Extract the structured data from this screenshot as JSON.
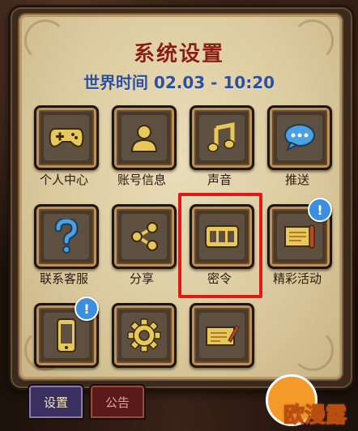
{
  "header": {
    "title": "系统设置",
    "world_time": "世界时间 02.03 - 10:20"
  },
  "tiles": [
    {
      "label": "个人中心",
      "icon": "gamepad-icon",
      "badge": ""
    },
    {
      "label": "账号信息",
      "icon": "person-icon",
      "badge": ""
    },
    {
      "label": "声音",
      "icon": "music-note-icon",
      "badge": ""
    },
    {
      "label": "推送",
      "icon": "chat-bubble-icon",
      "badge": ""
    },
    {
      "label": "联系客服",
      "icon": "question-icon",
      "badge": ""
    },
    {
      "label": "分享",
      "icon": "share-icon",
      "badge": ""
    },
    {
      "label": "密令",
      "icon": "code-pad-icon",
      "badge": ""
    },
    {
      "label": "精彩活动",
      "icon": "scroll-icon",
      "badge": "!"
    },
    {
      "label": "",
      "icon": "phone-icon",
      "badge": "!"
    },
    {
      "label": "",
      "icon": "gear-icon",
      "badge": ""
    },
    {
      "label": "",
      "icon": "letter-icon",
      "badge": ""
    }
  ],
  "bottom_tabs": {
    "settings": "设置",
    "notice": "公告"
  },
  "watermark": {
    "text": "欧漫露"
  },
  "colors": {
    "title": "#8a1e12",
    "time": "#2d4fa0",
    "highlight": "#e01818",
    "badge": "#3b8fe0"
  }
}
